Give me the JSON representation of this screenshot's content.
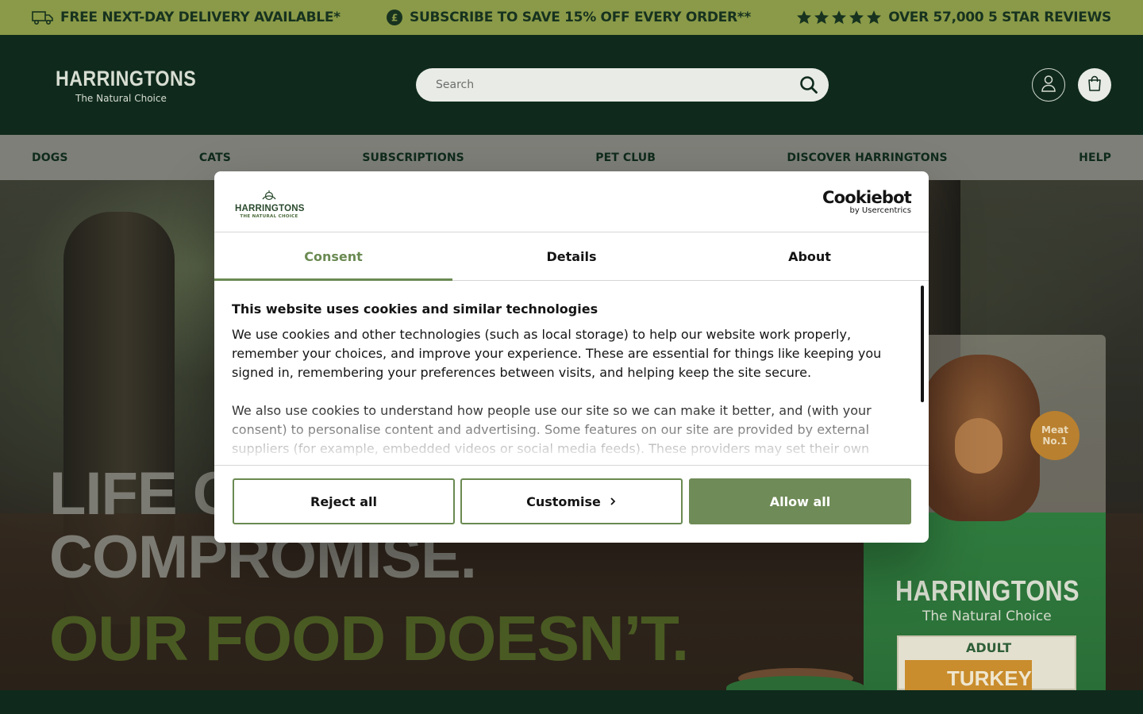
{
  "promo": {
    "delivery": "FREE NEXT-DAY DELIVERY AVAILABLE*",
    "subscribe": "SUBSCRIBE TO SAVE 15% OFF EVERY ORDER**",
    "reviews": "OVER 57,000 5 STAR REVIEWS",
    "star_rating": 5
  },
  "header": {
    "logo_main": "HARRINGTONS",
    "logo_sub": "The Natural Choice",
    "search_placeholder": "Search"
  },
  "nav": {
    "items": [
      "DOGS",
      "CATS",
      "SUBSCRIPTIONS",
      "PET CLUB",
      "DISCOVER HARRINGTONS",
      "HELP"
    ]
  },
  "hero": {
    "line1": "LIFE C",
    "line2": "COMPROMISE.",
    "line3": "OUR FOOD DOESN’T.",
    "bag_brand": "HARRINGTONS",
    "bag_sub": "The Natural Choice",
    "bag_adult": "ADULT",
    "bag_turkey": "TURKEY",
    "badge": "Meat No.1"
  },
  "modal": {
    "logo_main": "HARRINGTONS",
    "logo_sub": "THE NATURAL CHOICE",
    "cookiebot_main": "Cookiebot",
    "cookiebot_sub": "by Usercentrics",
    "tabs": [
      "Consent",
      "Details",
      "About"
    ],
    "active_tab": 0,
    "title": "This website uses cookies and similar technologies",
    "para1": "We use cookies and other technologies (such as local storage) to help our website work properly, remember your choices, and improve your experience. These are essential for things like keeping you signed in, remembering your preferences between visits, and helping keep the site secure.",
    "para2": "We also use cookies to understand how people use our site so we can make it better, and (with your consent) to personalise content and advertising. Some features on our site are provided by external suppliers (for example, embedded videos or social media feeds). These providers may set their own",
    "buttons": {
      "reject": "Reject all",
      "customise": "Customise",
      "allow": "Allow all"
    }
  },
  "colors": {
    "promo_bg": "#8a9a48",
    "header_bg": "#0f2a1c",
    "accent_green": "#6f8b57"
  }
}
